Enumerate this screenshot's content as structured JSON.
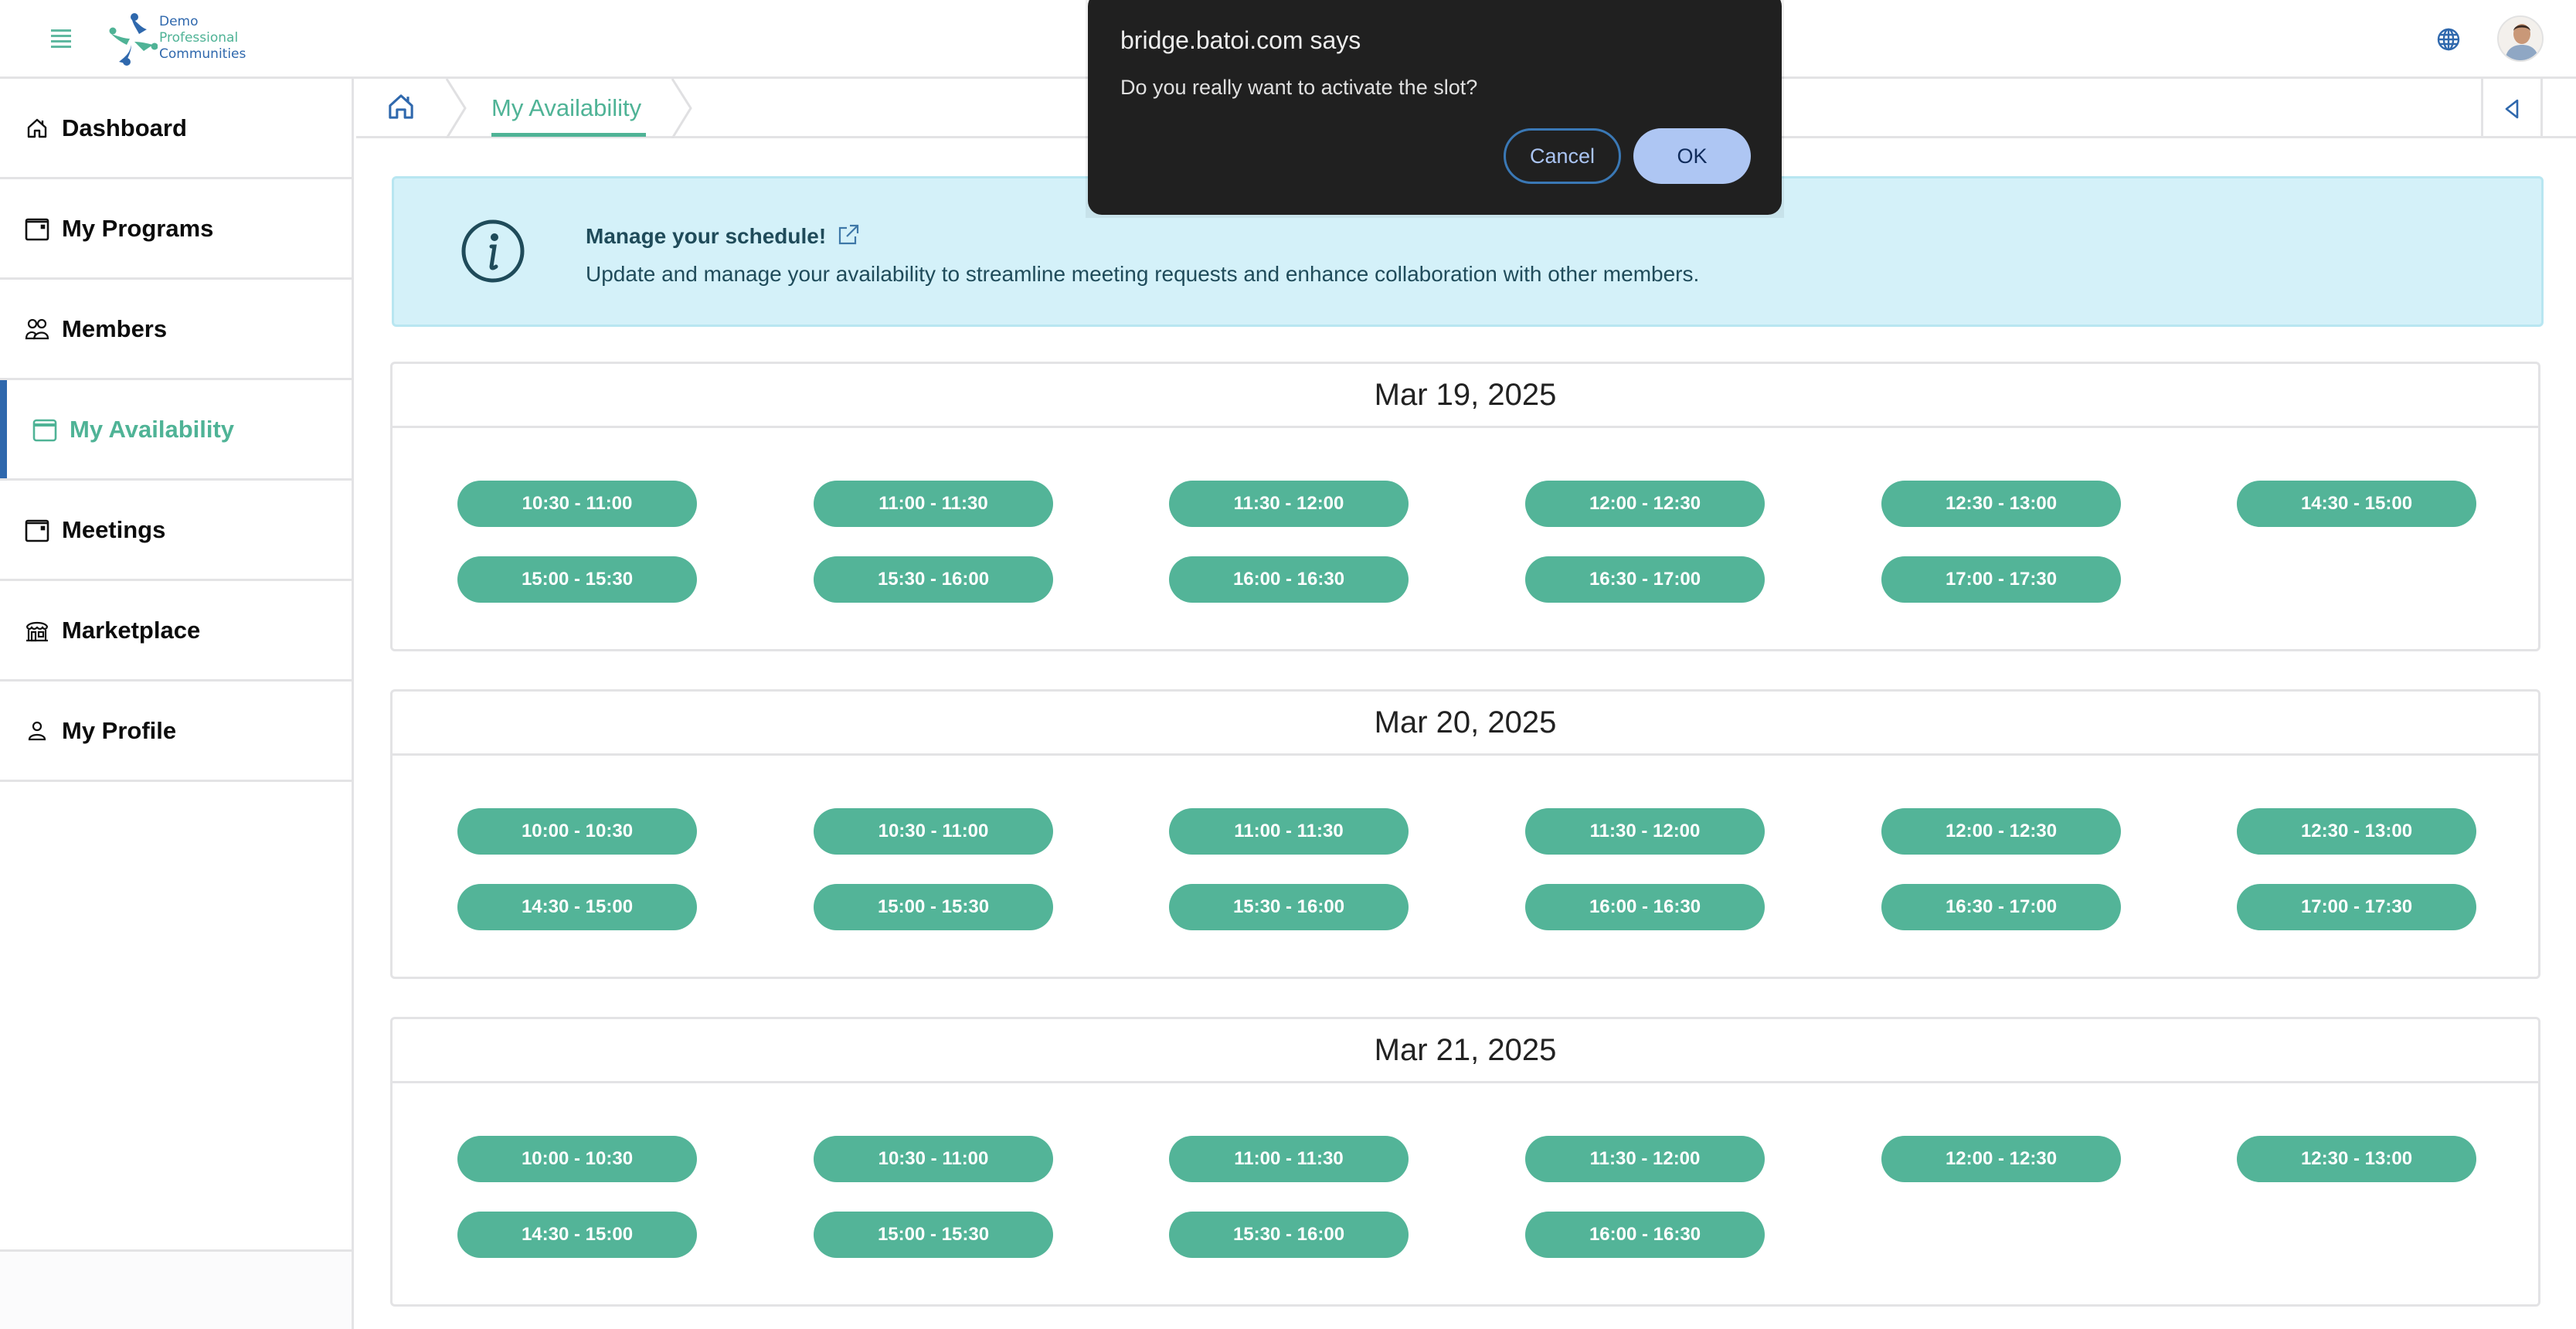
{
  "header": {
    "logo": {
      "line1": "Demo",
      "line2": "Professional",
      "line3": "Communities"
    }
  },
  "sidebar": {
    "items": [
      {
        "label": "Dashboard",
        "icon": "home-icon",
        "active": false
      },
      {
        "label": "My Programs",
        "icon": "calendar-icon",
        "active": false
      },
      {
        "label": "Members",
        "icon": "members-icon",
        "active": false
      },
      {
        "label": "My Availability",
        "icon": "calendar-icon",
        "active": true
      },
      {
        "label": "Meetings",
        "icon": "calendar-icon",
        "active": false
      },
      {
        "label": "Marketplace",
        "icon": "store-icon",
        "active": false
      },
      {
        "label": "My Profile",
        "icon": "user-icon",
        "active": false
      }
    ]
  },
  "breadcrumb": {
    "current": "My Availability"
  },
  "banner": {
    "title": "Manage your schedule!",
    "description": "Update and manage your availability to streamline meeting requests and enhance collaboration with other members."
  },
  "days": [
    {
      "date": "Mar 19, 2025",
      "slots": [
        "10:30 - 11:00",
        "11:00 - 11:30",
        "11:30 - 12:00",
        "12:00 - 12:30",
        "12:30 - 13:00",
        "14:30 - 15:00",
        "15:00 - 15:30",
        "15:30 - 16:00",
        "16:00 - 16:30",
        "16:30 - 17:00",
        "17:00 - 17:30"
      ]
    },
    {
      "date": "Mar 20, 2025",
      "slots": [
        "10:00 - 10:30",
        "10:30 - 11:00",
        "11:00 - 11:30",
        "11:30 - 12:00",
        "12:00 - 12:30",
        "12:30 - 13:00",
        "14:30 - 15:00",
        "15:00 - 15:30",
        "15:30 - 16:00",
        "16:00 - 16:30",
        "16:30 - 17:00",
        "17:00 - 17:30"
      ]
    },
    {
      "date": "Mar 21, 2025",
      "slots": [
        "10:00 - 10:30",
        "10:30 - 11:00",
        "11:00 - 11:30",
        "11:30 - 12:00",
        "12:00 - 12:30",
        "12:30 - 13:00",
        "14:30 - 15:00",
        "15:00 - 15:30",
        "15:30 - 16:00",
        "16:00 - 16:30"
      ]
    }
  ],
  "dialog": {
    "title": "bridge.batoi.com says",
    "message": "Do you really want to activate the slot?",
    "cancel_label": "Cancel",
    "ok_label": "OK"
  },
  "colors": {
    "accent_green": "#53b498",
    "brand_blue": "#2f68ad",
    "banner_bg": "#d4f1f9",
    "dialog_bg": "#202020",
    "ok_button": "#aec6f3"
  }
}
